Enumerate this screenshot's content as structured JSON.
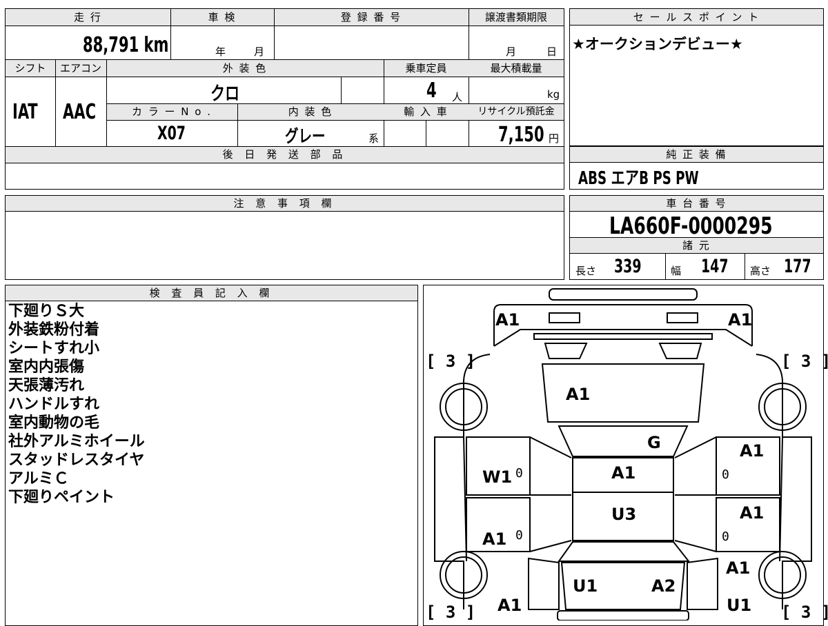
{
  "top_info": {
    "headers": {
      "mileage": "走 行",
      "inspection": "車 検",
      "registration": "登 録 番 号",
      "transfer_deadline": "譲渡書類期限",
      "shift": "シフト",
      "aircon": "エアコン",
      "exterior_color": "外 装 色",
      "capacity": "乗車定員",
      "max_load": "最大積載量",
      "color_no": "カ ラ ー N o .",
      "interior_color": "内 装 色",
      "import": "輸 入 車",
      "recycle": "リサイクル預託金",
      "later_parts": "後 日 発 送 部 品"
    },
    "mileage": "88,791 km",
    "inspection_year_unit": "年",
    "inspection_month_unit": "月",
    "deadline_month_unit": "月",
    "deadline_day_unit": "日",
    "shift": "IAT",
    "aircon": "AAC",
    "exterior_color": "クロ",
    "capacity": "4",
    "capacity_unit": "人",
    "max_load_unit": "kg",
    "color_no": "X07",
    "interior_color": "グレー",
    "interior_suffix": "系",
    "recycle_amount": "7,150",
    "recycle_unit": "円"
  },
  "sales_point": {
    "header": "セ ー ル ス ポ イ ン ト",
    "text": "★オークションデビュー★"
  },
  "genuine_equipment": {
    "header": "純 正 装 備",
    "text": "ABS エアB PS PW"
  },
  "caution": {
    "header": "注 意 事 項 欄"
  },
  "chassis": {
    "header": "車 台 番 号",
    "number": "LA660F-0000295",
    "specs_header": "諸 元",
    "length_label": "長さ",
    "length": "339",
    "width_label": "幅",
    "width": "147",
    "height_label": "高さ",
    "height": "177"
  },
  "inspector": {
    "header": "検 査 員 記 入 欄",
    "notes": [
      "下廻りＳ大",
      "外装鉄粉付着",
      "シートすれ小",
      "室内内張傷",
      "天張薄汚れ",
      "ハンドルすれ",
      "室内動物の毛",
      "社外アルミホイール",
      "スタッドレスタイヤ",
      "アルミＣ",
      "下廻りペイント"
    ]
  },
  "diagram": {
    "front_left": "A1",
    "front_right": "A1",
    "bracket_tl": "[ 3 ]",
    "bracket_tr": "[ 3 ]",
    "bracket_bl": "[ 3 ]",
    "bracket_br": "[ 3 ]",
    "hood": "A1",
    "windshield": "G",
    "left_front_door": "W1",
    "right_front_door": "A1",
    "roof_front": "A1",
    "roof_rear": "U3",
    "left_rear_door": "A1",
    "right_rear_door": "A1",
    "right_rear_fender": "A1",
    "left_rear_quarter": "A1",
    "rear_left": "U1",
    "rear_right": "A2",
    "right_bottom": "U1",
    "zero": "0"
  }
}
